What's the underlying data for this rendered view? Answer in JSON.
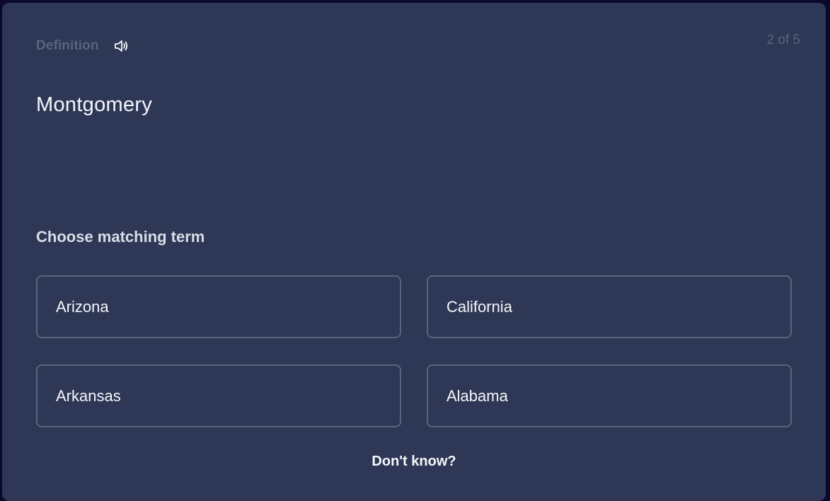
{
  "card": {
    "side_label": "Definition",
    "audio_icon": "speaker-icon",
    "counter": "2 of 5",
    "prompt": "Montgomery",
    "instruction": "Choose matching term",
    "options": [
      {
        "label": "Arizona"
      },
      {
        "label": "California"
      },
      {
        "label": "Arkansas"
      },
      {
        "label": "Alabama"
      }
    ],
    "dont_know": "Don't know?"
  },
  "colors": {
    "page_bg": "#0a092d",
    "card_bg": "#2e3856",
    "muted_text": "#586380",
    "primary_text": "#f6f7fb",
    "option_border": "#586380"
  }
}
